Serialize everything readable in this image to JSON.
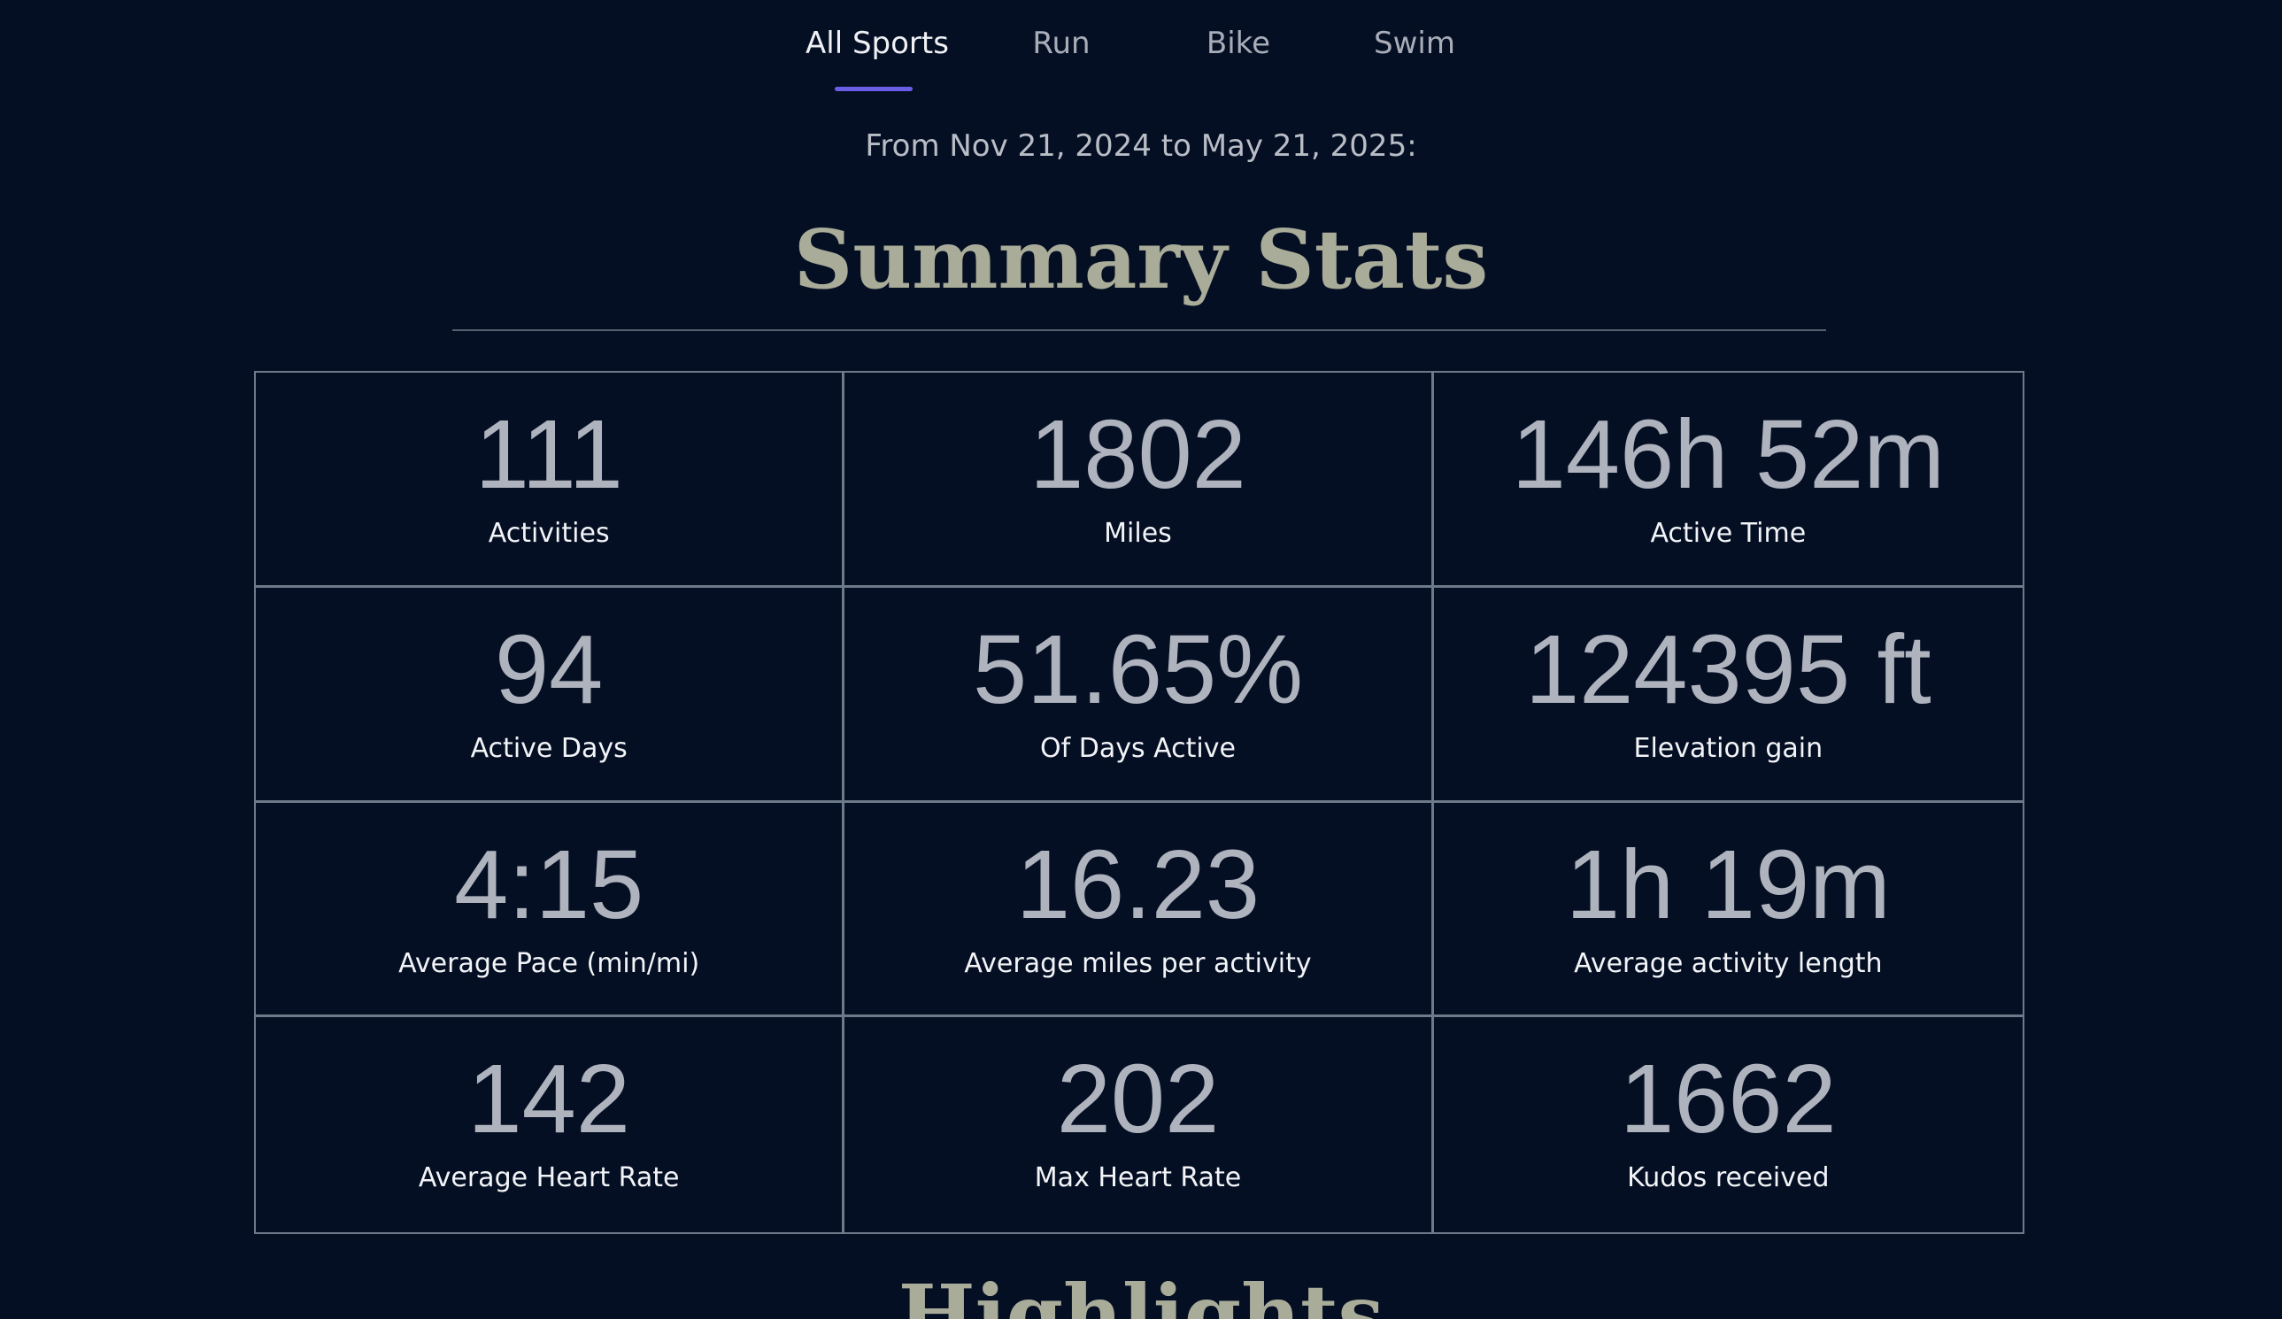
{
  "tabs": [
    {
      "label": "All Sports",
      "active": true
    },
    {
      "label": "Run",
      "active": false
    },
    {
      "label": "Bike",
      "active": false
    },
    {
      "label": "Swim",
      "active": false
    }
  ],
  "date_range": "From Nov 21, 2024 to May 21, 2025:",
  "summary": {
    "title": "Summary Stats",
    "stats": [
      {
        "value": "111",
        "label": "Activities"
      },
      {
        "value": "1802",
        "label": "Miles"
      },
      {
        "value": "146h 52m",
        "label": "Active Time"
      },
      {
        "value": "94",
        "label": "Active Days"
      },
      {
        "value": "51.65%",
        "label": "Of Days Active"
      },
      {
        "value": "124395 ft",
        "label": "Elevation gain"
      },
      {
        "value": "4:15",
        "label": "Average Pace (min/mi)"
      },
      {
        "value": "16.23",
        "label": "Average miles per activity"
      },
      {
        "value": "1h 19m",
        "label": "Average activity length"
      },
      {
        "value": "142",
        "label": "Average Heart Rate"
      },
      {
        "value": "202",
        "label": "Max Heart Rate"
      },
      {
        "value": "1662",
        "label": "Kudos received"
      }
    ]
  },
  "highlights": {
    "title": "Highlights"
  },
  "colors": {
    "background": "#050f24",
    "accent": "#6a5ee6",
    "title": "#a9ac98",
    "grid_border": "#6c7a8a"
  }
}
